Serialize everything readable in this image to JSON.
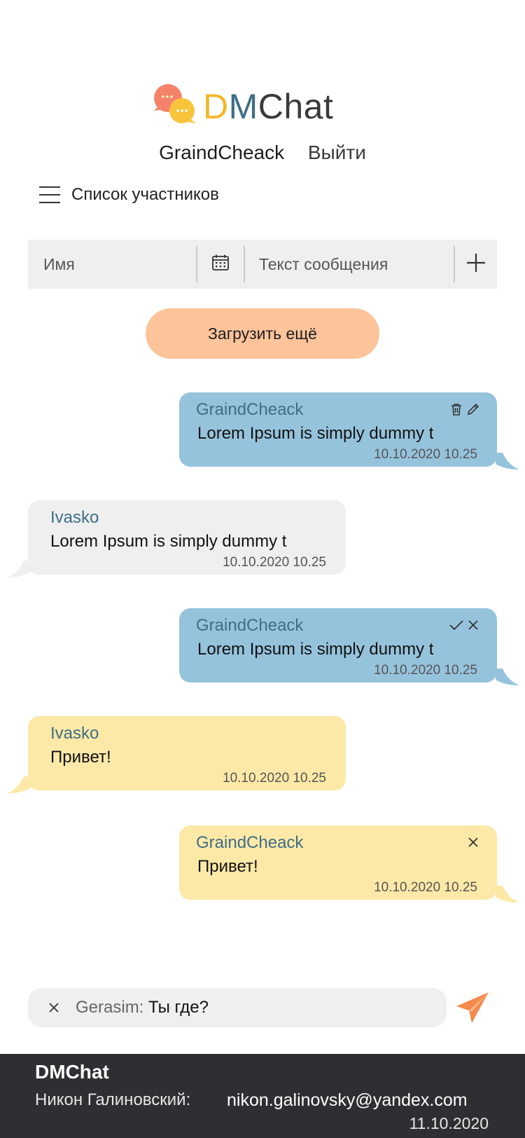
{
  "header": {
    "brand_d": "D",
    "brand_m": "M",
    "brand_chat": "Chat",
    "username": "GraindCheack",
    "logout_label": "Выйти",
    "members_label": "Список участников"
  },
  "filter": {
    "name_placeholder": "Имя",
    "text_placeholder": "Текст сообщения"
  },
  "load_more_label": "Загрузить ещё",
  "messages": [
    {
      "author": "GraindCheack",
      "text": "Lorem Ipsum is simply dummy t",
      "time": "10.10.2020 10.25",
      "color": "#96c3dc",
      "actions": [
        "trash-icon",
        "pencil-icon"
      ]
    },
    {
      "author": "Ivasko",
      "text": "Lorem Ipsum is simply dummy t",
      "time": "10.10.2020 10.25",
      "color": "#efefef",
      "actions": []
    },
    {
      "author": "GraindCheack",
      "text": "Lorem Ipsum is simply dummy t",
      "time": "10.10.2020 10.25",
      "color": "#96c3dc",
      "actions": [
        "check-icon",
        "close-icon"
      ]
    },
    {
      "author": "Ivasko",
      "text": "Привет!",
      "time": "10.10.2020 10.25",
      "color": "#fde9a7",
      "actions": []
    },
    {
      "author": "GraindCheack",
      "text": "Привет!",
      "time": "10.10.2020 10.25",
      "color": "#fde9a7",
      "actions": [
        "close-icon"
      ]
    }
  ],
  "compose": {
    "reply_name": "Gerasim:",
    "reply_text": " Ты где?"
  },
  "footer": {
    "brand": "DMChat",
    "author": "Никон Галиновский:",
    "email": "nikon.galinovsky@yandex.com",
    "date": "11.10.2020"
  },
  "colors": {
    "accent_orange": "#fdc39b",
    "send_orange": "#f58a4c",
    "author_blue": "#3f6e86",
    "footer_bg": "#2f2f33"
  }
}
